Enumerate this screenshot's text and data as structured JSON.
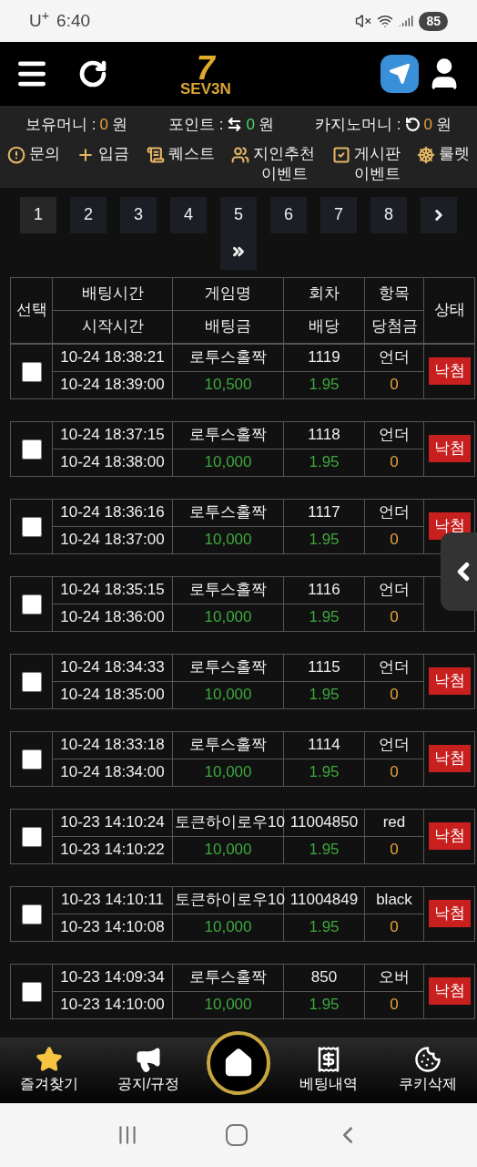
{
  "status_bar": {
    "carrier": "U$^{+}$",
    "time": "6:40",
    "battery": "85"
  },
  "header": {
    "logo_mark": "7",
    "logo_text": "SEV3N"
  },
  "balances": [
    {
      "label": "보유머니 :",
      "kind": "plain",
      "value": "0",
      "color": "#e8a23a",
      "unit": "원"
    },
    {
      "label": "포인트 :",
      "kind": "exchange",
      "value": "0",
      "color": "#4cd964",
      "unit": "원"
    },
    {
      "label": "카지노머니 :",
      "kind": "refresh",
      "value": "0",
      "color": "#e8a23a",
      "unit": "원"
    }
  ],
  "menu": [
    {
      "kind": "info",
      "lines": [
        "문의"
      ]
    },
    {
      "kind": "plus",
      "lines": [
        "입금"
      ]
    },
    {
      "kind": "scroll",
      "lines": [
        "퀘스트"
      ]
    },
    {
      "kind": "people",
      "lines": [
        "지인추천",
        "이벤트"
      ]
    },
    {
      "kind": "check",
      "lines": [
        "게시판",
        "이벤트"
      ]
    },
    {
      "kind": "wheel",
      "lines": [
        "룰렛"
      ]
    }
  ],
  "pagination": {
    "pages": [
      {
        "label": "1",
        "selected": true
      },
      {
        "label": "2",
        "selected": false
      },
      {
        "label": "3",
        "selected": false
      },
      {
        "label": "4",
        "selected": false
      },
      {
        "label": "5",
        "selected": false
      },
      {
        "label": "6",
        "selected": false
      },
      {
        "label": "7",
        "selected": false
      },
      {
        "label": "8",
        "selected": false
      }
    ]
  },
  "table": {
    "select_column": "선택",
    "status_column": "상태",
    "columns_top": [
      "배팅시간",
      "게임명",
      "회차",
      "항목"
    ],
    "columns_bottom": [
      "시작시간",
      "배팅금",
      "배당",
      "당첨금"
    ],
    "rows": [
      {
        "checked": false,
        "bet_time": "10-24 18:38:21",
        "game": "로투스홀짝",
        "round": "1119",
        "pick": "언더",
        "start_time": "10-24 18:39:00",
        "amount": "10,500",
        "odds": "1.95",
        "payout": "0",
        "status": "낙첨"
      },
      {
        "checked": false,
        "bet_time": "10-24 18:37:15",
        "game": "로투스홀짝",
        "round": "1118",
        "pick": "언더",
        "start_time": "10-24 18:38:00",
        "amount": "10,000",
        "odds": "1.95",
        "payout": "0",
        "status": "낙첨"
      },
      {
        "checked": false,
        "bet_time": "10-24 18:36:16",
        "game": "로투스홀짝",
        "round": "1117",
        "pick": "언더",
        "start_time": "10-24 18:37:00",
        "amount": "10,000",
        "odds": "1.95",
        "payout": "0",
        "status": "낙첨"
      },
      {
        "checked": false,
        "bet_time": "10-24 18:35:15",
        "game": "로투스홀짝",
        "round": "1116",
        "pick": "언더",
        "start_time": "10-24 18:36:00",
        "amount": "10,000",
        "odds": "1.95",
        "payout": "0"
      },
      {
        "checked": false,
        "bet_time": "10-24 18:34:33",
        "game": "로투스홀짝",
        "round": "1115",
        "pick": "언더",
        "start_time": "10-24 18:35:00",
        "amount": "10,000",
        "odds": "1.95",
        "payout": "0",
        "status": "낙첨"
      },
      {
        "checked": false,
        "bet_time": "10-24 18:33:18",
        "game": "로투스홀짝",
        "round": "1114",
        "pick": "언더",
        "start_time": "10-24 18:34:00",
        "amount": "10,000",
        "odds": "1.95",
        "payout": "0",
        "status": "낙첨"
      },
      {
        "checked": false,
        "bet_time": "10-23 14:10:24",
        "game": "토큰하이로우10",
        "round": "11004850",
        "pick": "red",
        "start_time": "10-23 14:10:22",
        "amount": "10,000",
        "odds": "1.95",
        "payout": "0",
        "status": "낙첨"
      },
      {
        "checked": false,
        "bet_time": "10-23 14:10:11",
        "game": "토큰하이로우10",
        "round": "11004849",
        "pick": "black",
        "start_time": "10-23 14:10:08",
        "amount": "10,000",
        "odds": "1.95",
        "payout": "0",
        "status": "낙첨"
      },
      {
        "checked": false,
        "bet_time": "10-23 14:09:34",
        "game": "로투스홀짝",
        "round": "850",
        "pick": "오버",
        "start_time": "10-23 14:10:00",
        "amount": "10,000",
        "odds": "1.95",
        "payout": "0",
        "status": "낙첨"
      }
    ]
  },
  "bottom_nav": [
    {
      "kind": "star",
      "label": "즐겨찾기"
    },
    {
      "kind": "megaphone",
      "label": "공지/규정"
    },
    {
      "kind": "home"
    },
    {
      "kind": "bet",
      "label": "베팅내역"
    },
    {
      "kind": "cookie",
      "label": "쿠키삭제"
    }
  ]
}
